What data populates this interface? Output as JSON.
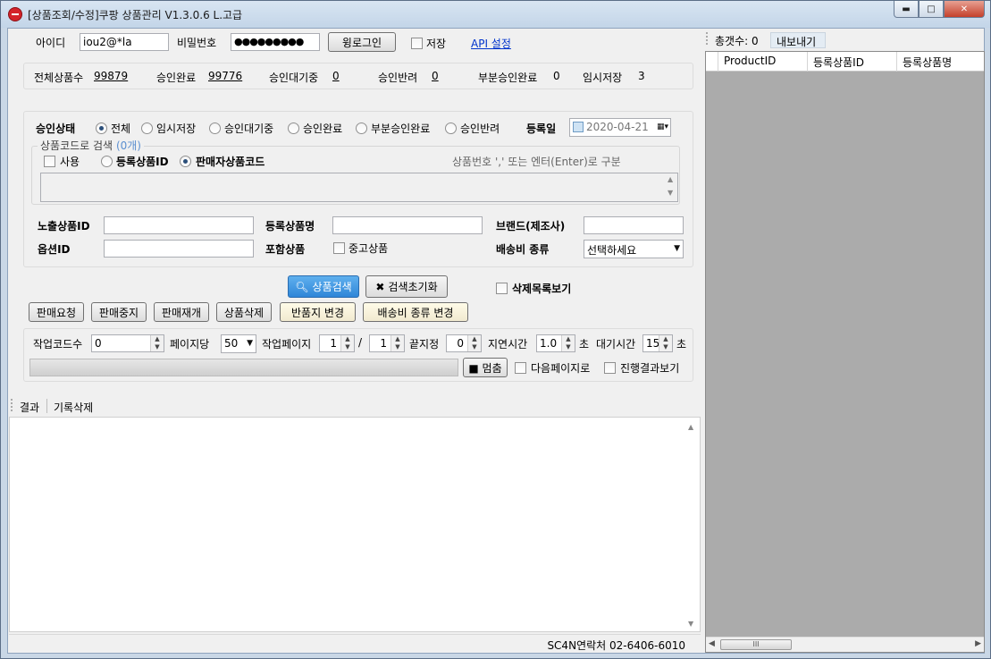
{
  "window": {
    "title": "[상품조회/수정]쿠팡 상품관리 V1.3.0.6 L.고급",
    "min": "▬",
    "max": "□",
    "close": "✕"
  },
  "login": {
    "id_label": "아이디",
    "id_value": "iou2@*la",
    "pw_label": "비밀번호",
    "pw_value": "●●●●●●●●●",
    "login_button": "윙로그인",
    "save_label": "저장",
    "api_link": "API 설정"
  },
  "stats": {
    "total_label": "전체상품수",
    "total_value": "99879",
    "approved_label": "승인완료",
    "approved_value": "99776",
    "waiting_label": "승인대기중",
    "waiting_value": "0",
    "rejected_label": "승인반려",
    "rejected_value": "0",
    "partial_label": "부분승인완료",
    "partial_value": "0",
    "temp_label": "임시저장",
    "temp_value": "3"
  },
  "filter": {
    "status_label": "승인상태",
    "status_options": [
      "전체",
      "임시저장",
      "승인대기중",
      "승인완료",
      "부분승인완료",
      "승인반려"
    ],
    "reg_date_label": "등록일",
    "reg_date_value": "2020-04-21",
    "code_group_label": "상품코드로 검색",
    "code_group_count": "(0개)",
    "use_label": "사용",
    "reg_id_label": "등록상품ID",
    "seller_code_label": "판매자상품코드",
    "hint": "상품번호 ',' 또는 엔터(Enter)로 구분",
    "exposed_id_label": "노출상품ID",
    "reg_name_label": "등록상품명",
    "brand_label": "브랜드(제조사)",
    "option_id_label": "옵션ID",
    "include_label": "포함상품",
    "used_label": "중고상품",
    "shipping_label": "배송비 종류",
    "shipping_value": "선택하세요"
  },
  "actions": {
    "search": "상품검색",
    "reset": "검색초기화",
    "deleted_list": "삭제목록보기",
    "sell_request": "판매요청",
    "sell_stop": "판매중지",
    "sell_resume": "판매재개",
    "delete": "상품삭제",
    "return_change": "반품지 변경",
    "shipping_change": "배송비 종류 변경"
  },
  "job": {
    "code_count_label": "작업코드수",
    "code_count_value": "0",
    "per_page_label": "페이지당",
    "per_page_value": "50",
    "work_page_label": "작업페이지",
    "work_page_value": "1",
    "slash": "/",
    "work_page_total": "1",
    "end_label": "끝지정",
    "end_value": "0",
    "delay_label": "지연시간",
    "delay_value": "1.0",
    "delay_unit": "초",
    "wait_label": "대기시간",
    "wait_value": "15",
    "wait_unit": "초",
    "stop_button": "■ 멈춤",
    "next_page_label": "다음페이지로",
    "show_progress_label": "진행결과보기"
  },
  "results": {
    "tab_result": "결과",
    "tab_clear": "기록삭제",
    "footer": "SC4N연락처 02-6406-6010"
  },
  "right_panel": {
    "count_label": "총갯수: 0",
    "export_button": "내보내기",
    "columns": [
      "ProductID",
      "등록상품ID",
      "등록상품명"
    ],
    "hscroll_thumb": "III"
  }
}
